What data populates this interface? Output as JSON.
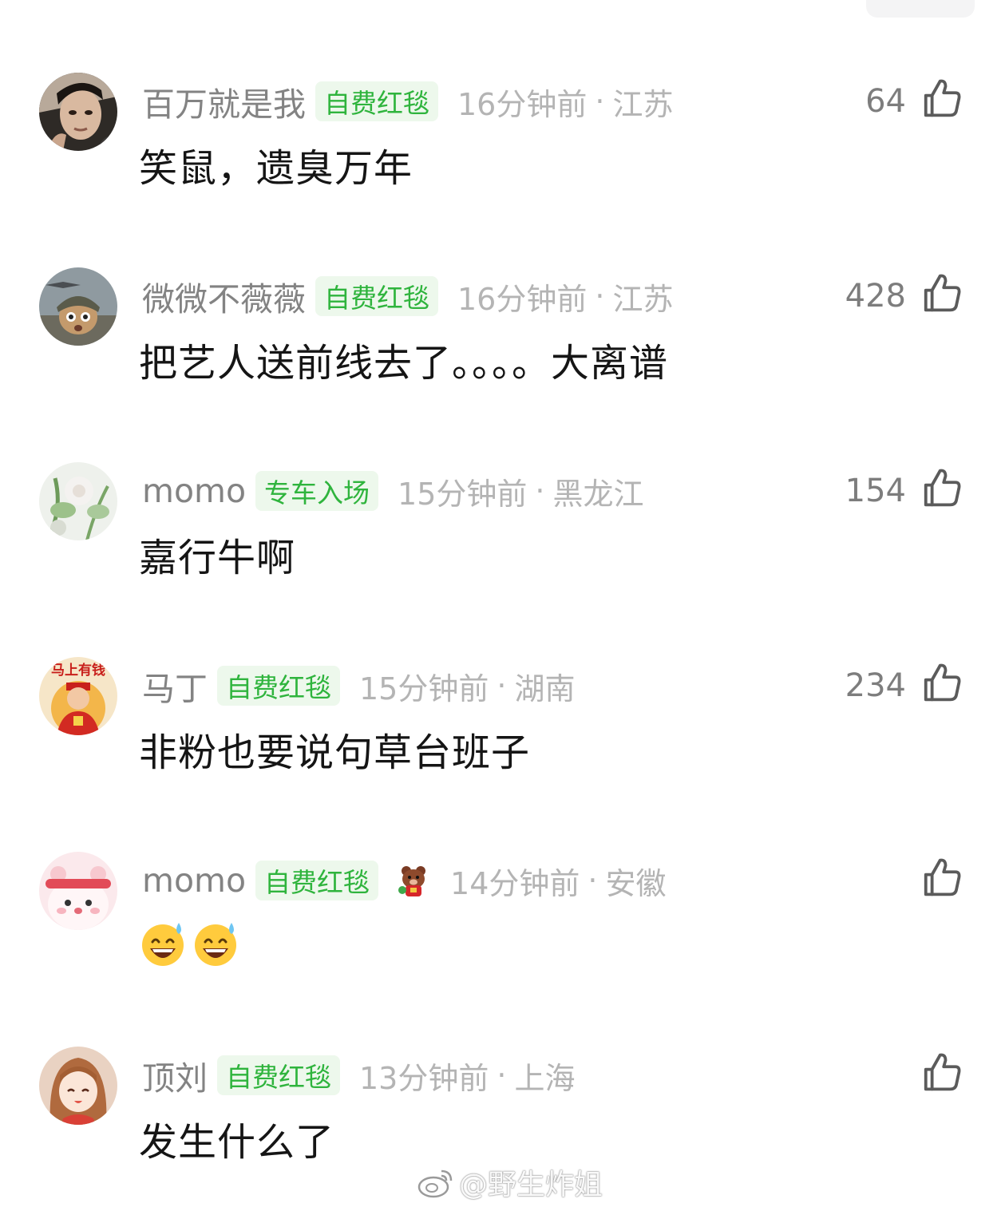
{
  "comments": [
    {
      "username": "百万就是我",
      "badge": "自费红毯",
      "time": "16分钟前",
      "region": "江苏",
      "likes": "64",
      "text": "笑鼠，遗臭万年",
      "avatar": "photo-man-avatar"
    },
    {
      "username": "微微不薇薇",
      "badge": "自费红毯",
      "time": "16分钟前",
      "region": "江苏",
      "likes": "428",
      "text": "把艺人送前线去了。。。。大离谱",
      "avatar": "cat-helmet-avatar"
    },
    {
      "username": "momo",
      "badge": "专车入场",
      "time": "15分钟前",
      "region": "黑龙江",
      "likes": "154",
      "text": "嘉行牛啊",
      "avatar": "flower-avatar"
    },
    {
      "username": "马丁",
      "badge": "自费红毯",
      "time": "15分钟前",
      "region": "湖南",
      "likes": "234",
      "text": "非粉也要说句草台班子",
      "avatar": "new-year-kid-avatar",
      "avatar_text": "马上有钱"
    },
    {
      "username": "momo",
      "badge": "自费红毯",
      "time": "14分钟前",
      "region": "安徽",
      "likes": "",
      "text": "",
      "emojis": [
        "grinning-sweat-emoji",
        "grinning-sweat-emoji"
      ],
      "sticker": "bear-sticker-icon",
      "avatar": "pink-bun-avatar"
    },
    {
      "username": "顶刘",
      "badge": "自费红毯",
      "time": "13分钟前",
      "region": "上海",
      "likes": "",
      "text": "发生什么了",
      "avatar": "anime-girl-avatar"
    }
  ],
  "separator": "·",
  "watermark": {
    "text": "@野生炸姐",
    "icon": "weibo-logo-icon"
  },
  "colors": {
    "badge_bg": "#edf8ec",
    "badge_text": "#2fb43d",
    "meta": "#b4b4b4",
    "username": "#838383"
  }
}
